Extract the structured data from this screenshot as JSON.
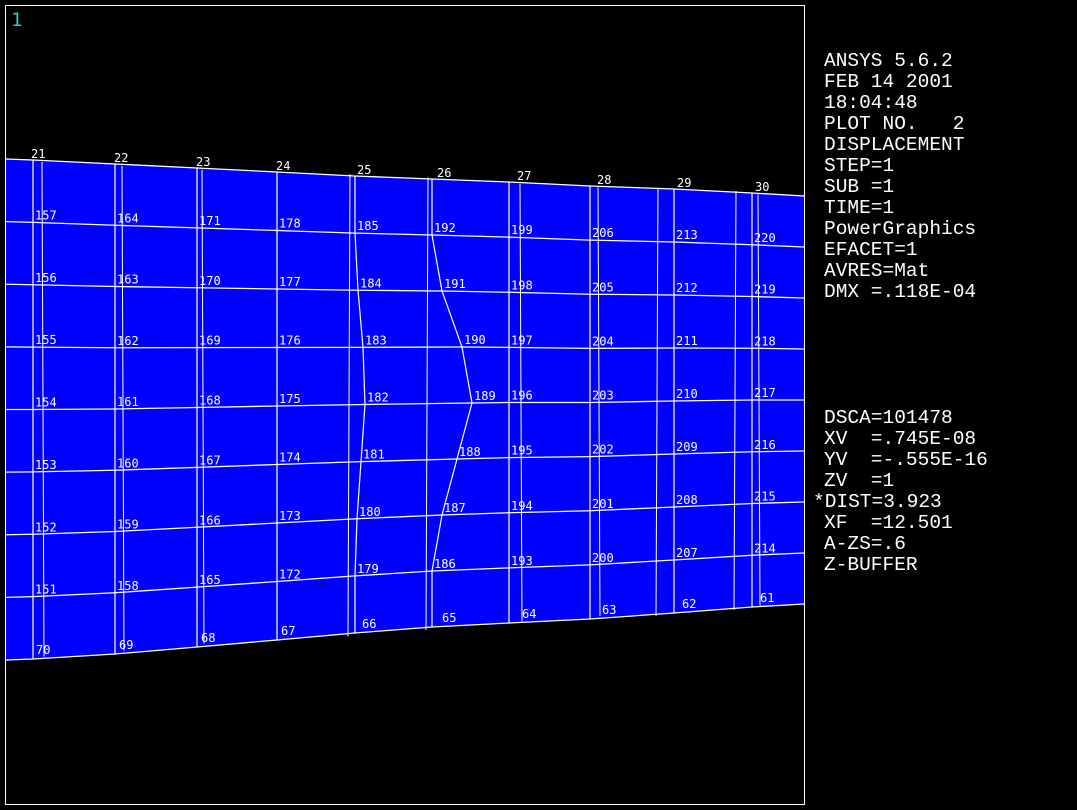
{
  "window_number": "1",
  "legend": {
    "lines_top": [
      "ANSYS 5.6.2",
      "FEB 14 2001",
      "18:04:48",
      "PLOT NO.   2",
      "DISPLACEMENT",
      "STEP=1",
      "SUB =1",
      "TIME=1",
      "PowerGraphics",
      "EFACET=1",
      "AVRES=Mat",
      "DMX =.118E-04"
    ],
    "lines_bottom": [
      "DSCA=101478",
      "XV  =.745E-08",
      "YV  =-.555E-16",
      "ZV  =1",
      "*DIST=3.923",
      "XF  =12.501",
      "A-ZS=.6",
      "Z-BUFFER"
    ]
  },
  "mesh": {
    "top_row_labels": [
      "21",
      "22",
      "23",
      "24",
      "25",
      "26",
      "27",
      "28",
      "29",
      "30"
    ],
    "bottom_row_labels": [
      "70",
      "69",
      "68",
      "67",
      "66",
      "65",
      "64",
      "63",
      "62",
      "61"
    ],
    "interior_columns": [
      [
        "157",
        "156",
        "155",
        "154",
        "153",
        "152",
        "151"
      ],
      [
        "164",
        "163",
        "162",
        "161",
        "160",
        "159",
        "158"
      ],
      [
        "171",
        "170",
        "169",
        "168",
        "167",
        "166",
        "165"
      ],
      [
        "178",
        "177",
        "176",
        "175",
        "174",
        "173",
        "172"
      ],
      [
        "185",
        "184",
        "183",
        "182",
        "181",
        "180",
        "179"
      ],
      [
        "192",
        "191",
        "190",
        "189",
        "188",
        "187",
        "186"
      ],
      [
        "199",
        "198",
        "197",
        "196",
        "195",
        "194",
        "193"
      ],
      [
        "206",
        "205",
        "204",
        "203",
        "202",
        "201",
        "200"
      ],
      [
        "213",
        "212",
        "211",
        "210",
        "209",
        "208",
        "207"
      ],
      [
        "220",
        "219",
        "218",
        "217",
        "216",
        "215",
        "214"
      ]
    ]
  },
  "colors": {
    "background": "#000000",
    "mesh_fill": "#0000ff",
    "mesh_lines": "#ffffff",
    "frame": "#ffffff",
    "window_number": "#31c8c8",
    "legend_text": "#ffffff"
  }
}
